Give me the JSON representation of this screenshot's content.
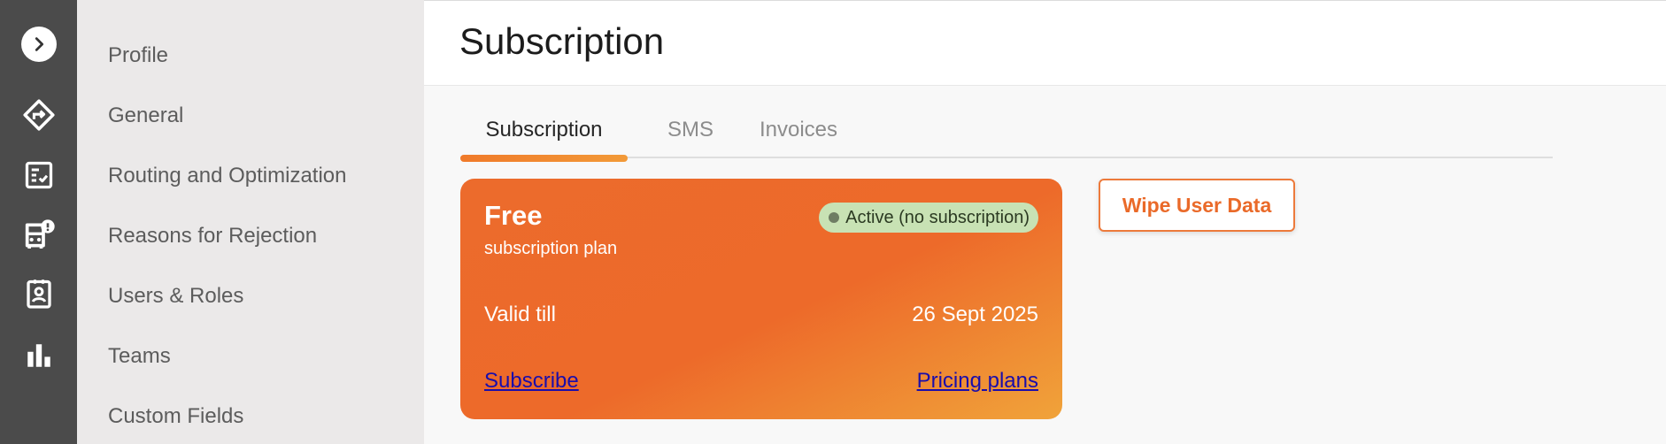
{
  "rail": {
    "items": [
      {
        "icon": "chevron-right-icon"
      },
      {
        "icon": "route-icon"
      },
      {
        "icon": "checklist-icon"
      },
      {
        "icon": "bus-alert-icon"
      },
      {
        "icon": "contact-card-icon"
      },
      {
        "icon": "bar-chart-icon"
      }
    ]
  },
  "settings_menu": {
    "items": [
      {
        "label": "Profile"
      },
      {
        "label": "General"
      },
      {
        "label": "Routing and Optimization"
      },
      {
        "label": "Reasons for Rejection"
      },
      {
        "label": "Users & Roles"
      },
      {
        "label": "Teams"
      },
      {
        "label": "Custom Fields"
      }
    ]
  },
  "header": {
    "title": "Subscription"
  },
  "tabs": [
    {
      "label": "Subscription",
      "active": true
    },
    {
      "label": "SMS",
      "active": false
    },
    {
      "label": "Invoices",
      "active": false
    }
  ],
  "plan": {
    "name": "Free",
    "subtitle": "subscription plan",
    "status": "Active (no subscription)",
    "valid_label": "Valid till",
    "valid_value": "26 Sept 2025",
    "subscribe_link": "Subscribe",
    "pricing_link": "Pricing plans"
  },
  "actions": {
    "wipe_label": "Wipe User Data"
  },
  "colors": {
    "accent": "#ec6b2c",
    "rail_bg": "#4b4b4b",
    "menu_bg": "#ebe9e9",
    "status_bg": "#c8e2b4",
    "link": "#1a0dab"
  }
}
